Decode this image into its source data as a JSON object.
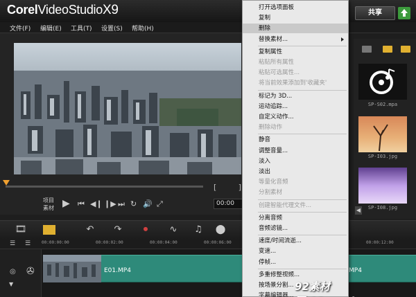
{
  "app": {
    "brand": "Corel",
    "product": "VideoStudio",
    "version": "X9"
  },
  "header": {
    "share_label": "共享"
  },
  "menubar": {
    "items": [
      "文件(F)",
      "编辑(E)",
      "工具(T)",
      "设置(S)",
      "帮助(H)"
    ]
  },
  "player": {
    "mode_project": "项目",
    "mode_clip": "素材",
    "timecode": "00:00",
    "trim_marks": "[ ]"
  },
  "library": {
    "thumbnails": [
      {
        "label": "SP-S02.mpa"
      },
      {
        "label": "SP-I03.jpg"
      },
      {
        "label": "SP-I08.jpg"
      }
    ]
  },
  "timeline": {
    "ruler_ticks": [
      "00:00:00:00",
      "00:00:02:00",
      "00:00:04:00",
      "00:00:06:00",
      "00:00:12:00"
    ],
    "clips": [
      {
        "label": "E01.MP4"
      },
      {
        "label": "MP4"
      }
    ]
  },
  "context_menu": {
    "items": [
      {
        "label": "打开选项面板",
        "enabled": true
      },
      {
        "label": "复制",
        "enabled": true
      },
      {
        "label": "删除",
        "enabled": true,
        "highlighted": true
      },
      {
        "label": "替换素材...",
        "enabled": true,
        "submenu": true
      },
      {
        "label": "复制属性",
        "enabled": true
      },
      {
        "label": "粘贴所有属性",
        "enabled": false
      },
      {
        "label": "粘贴可选属性...",
        "enabled": false
      },
      {
        "label": "将当前效果添加到'收藏夹'",
        "enabled": false
      },
      {
        "label": "标记为 3D...",
        "enabled": true
      },
      {
        "label": "运动追踪...",
        "enabled": true
      },
      {
        "label": "自定义动作...",
        "enabled": true
      },
      {
        "label": "删除动作",
        "enabled": false
      },
      {
        "label": "静音",
        "enabled": true
      },
      {
        "label": "调整音量...",
        "enabled": true
      },
      {
        "label": "淡入",
        "enabled": true
      },
      {
        "label": "淡出",
        "enabled": true
      },
      {
        "label": "等量化音频",
        "enabled": false
      },
      {
        "label": "分割素材",
        "enabled": false
      },
      {
        "label": "创建智能代理文件...",
        "enabled": false
      },
      {
        "label": "分离音频",
        "enabled": true
      },
      {
        "label": "音频滤镜...",
        "enabled": true
      },
      {
        "label": "速度/时间流逝...",
        "enabled": true
      },
      {
        "label": "变速...",
        "enabled": true
      },
      {
        "label": "停帧...",
        "enabled": true
      },
      {
        "label": "多重修整视频...",
        "enabled": true
      },
      {
        "label": "按场景分割...",
        "enabled": true
      },
      {
        "label": "字幕编辑器...",
        "enabled": true
      }
    ]
  },
  "watermark": "92素材网-92sucai.com"
}
